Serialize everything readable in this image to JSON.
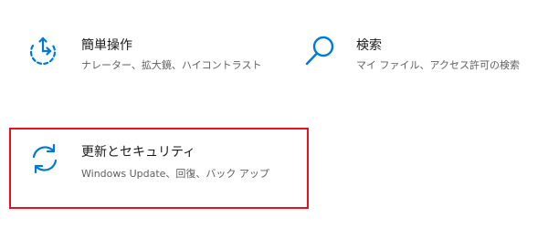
{
  "accent_color": "#0078d7",
  "focus_border_color": "#e81123",
  "tiles": [
    {
      "title": "簡単操作",
      "description": "ナレーター、拡大鏡、ハイコントラスト",
      "icon": "ease-of-access-icon"
    },
    {
      "title": "検索",
      "description": "マイ ファイル、アクセス許可の検索",
      "icon": "search-icon"
    },
    {
      "title": "更新とセキュリティ",
      "description": "Windows Update、回復、バック アップ",
      "icon": "sync-icon",
      "selected": true
    }
  ]
}
